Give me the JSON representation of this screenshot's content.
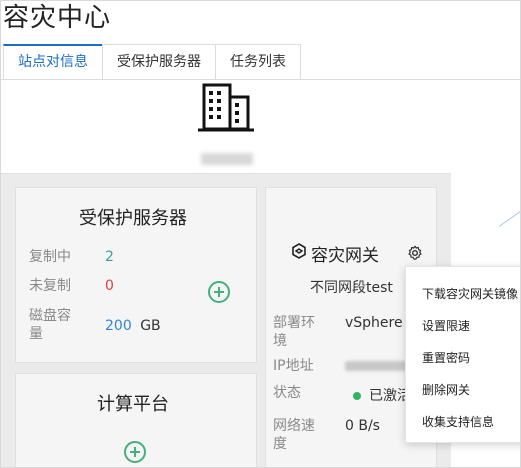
{
  "page": {
    "title": "容灾中心"
  },
  "tabs": [
    {
      "label": "站点对信息",
      "active": true
    },
    {
      "label": "受保护服务器",
      "active": false
    },
    {
      "label": "任务列表",
      "active": false
    }
  ],
  "site": {
    "icon": "building-icon"
  },
  "protected_servers": {
    "title": "受保护服务器",
    "replicating_label": "复制中",
    "replicating_value": "2",
    "unreplicated_label": "未复制",
    "unreplicated_value": "0",
    "disk_label_line1": "磁盘容",
    "disk_label_line2": "量",
    "disk_value": "200",
    "disk_unit": "GB"
  },
  "compute_platform": {
    "title": "计算平台"
  },
  "gateway": {
    "title": "容灾网关",
    "name": "不同网段test",
    "env_label_line1": "部署环",
    "env_label_line2": "境",
    "env_value": "vSphere",
    "ip_label": "IP地址",
    "status_label": "状态",
    "status_value": "已激活",
    "speed_label_line1": "网络速",
    "speed_label_line2": "度",
    "speed_value": "0 B/s"
  },
  "gateway_menu": {
    "items": [
      "下载容灾网关镜像",
      "设置限速",
      "重置密码",
      "删除网关",
      "收集支持信息"
    ]
  },
  "colors": {
    "accent": "#1b6ec2",
    "green": "#43b07a",
    "teal_value": "#3aa28a",
    "red": "#e0403a",
    "blue_value": "#2f86d6",
    "status_dot": "#2db45d"
  }
}
